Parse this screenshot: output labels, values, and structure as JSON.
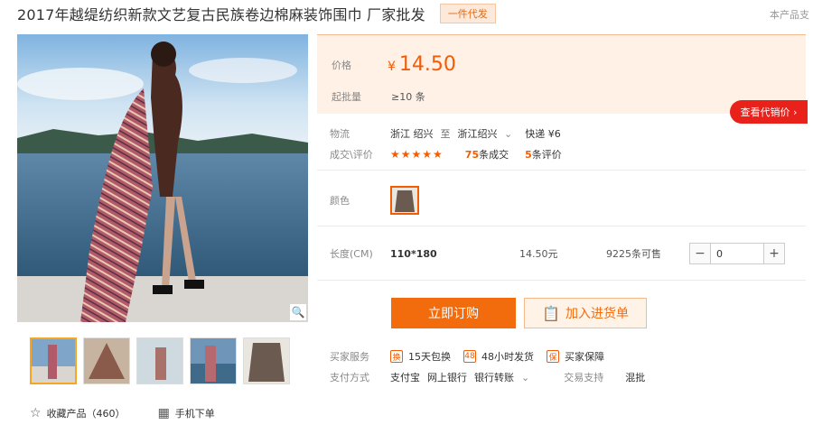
{
  "header": {
    "title": "2017年越缇纺织新款文艺复古民族卷边棉麻装饰围巾 厂家批发",
    "badge": "一件代发",
    "corner_note": "本产品支"
  },
  "price": {
    "label": "价格",
    "currency": "¥",
    "value": "14.50",
    "moq_label": "起批量",
    "moq_value": "≥10 条",
    "agent_button": "查看代销价 ›"
  },
  "shipping": {
    "label": "物流",
    "from": "浙江 绍兴",
    "to_word": "至",
    "to": "浙江绍兴",
    "method": "快递 ¥6"
  },
  "sales": {
    "label": "成交\\评价",
    "stars": "★★★★★",
    "deals_count": "75",
    "deals_text": "条成交",
    "reviews_count": "5",
    "reviews_text": "条评价"
  },
  "color": {
    "label": "颜色"
  },
  "sku": {
    "label": "长度(CM)",
    "size": "110*180",
    "price": "14.50元",
    "stock": "9225条可售",
    "minus": "−",
    "quantity": "0",
    "plus": "+"
  },
  "actions": {
    "buy": "立即订购",
    "cart": "加入进货单"
  },
  "services": {
    "label": "买家服务",
    "items": [
      "15天包换",
      "48小时发货",
      "买家保障"
    ]
  },
  "payment": {
    "label": "支付方式",
    "methods": [
      "支付宝",
      "网上银行",
      "银行转账"
    ],
    "trade_label": "交易支持",
    "trade_value": "混批"
  },
  "bottom": {
    "favorite": "收藏产品（460）",
    "mobile": "手机下单"
  },
  "colors": {
    "accent": "#f25c05",
    "agent_red": "#e8211a"
  }
}
